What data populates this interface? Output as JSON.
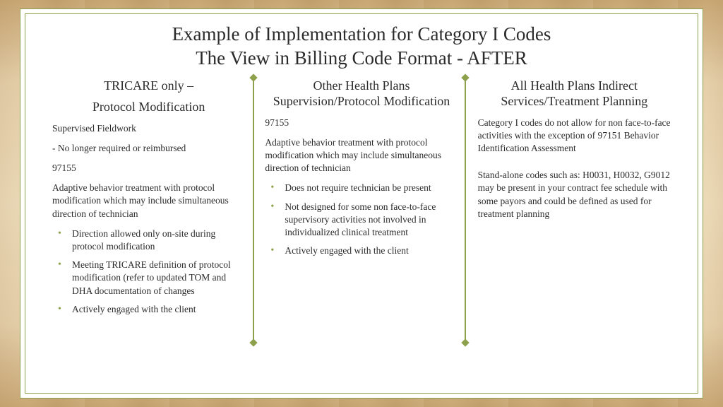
{
  "title": {
    "line1": "Example of Implementation for Category I Codes",
    "line2": "The View in Billing Code Format - AFTER"
  },
  "columns": [
    {
      "heading_line1": "TRICARE only –",
      "heading_line2": "Protocol Modification",
      "body": {
        "p1": "Supervised Fieldwork",
        "p2": "- No longer required or reimbursed",
        "p3": "97155",
        "p4": "Adaptive behavior treatment with protocol modification which may include simultaneous direction of technician"
      },
      "bullets": [
        "Direction allowed only on-site during protocol modification",
        "Meeting TRICARE definition of protocol modification (refer to updated TOM and DHA documentation of changes",
        "Actively engaged with the client"
      ]
    },
    {
      "heading_line1": "Other Health Plans",
      "heading_line2": "Supervision/Protocol Modification",
      "body": {
        "p1": "97155",
        "p2": "Adaptive behavior treatment with protocol modification which may include simultaneous direction of technician"
      },
      "bullets": [
        "Does not require technician be present",
        "Not designed for some non face-to-face supervisory activities not involved in individualized clinical treatment",
        "Actively engaged with the client"
      ]
    },
    {
      "heading_line1": "All Health Plans Indirect",
      "heading_line2": "Services/Treatment Planning",
      "body": {
        "p1": "Category I codes do not allow for non face-to-face activities with the exception of 97151 Behavior Identification Assessment",
        "p2": "Stand-alone codes such as: H0031, H0032, G9012 may be present in your contract fee schedule with some payors and could be defined as used for treatment planning"
      }
    }
  ]
}
